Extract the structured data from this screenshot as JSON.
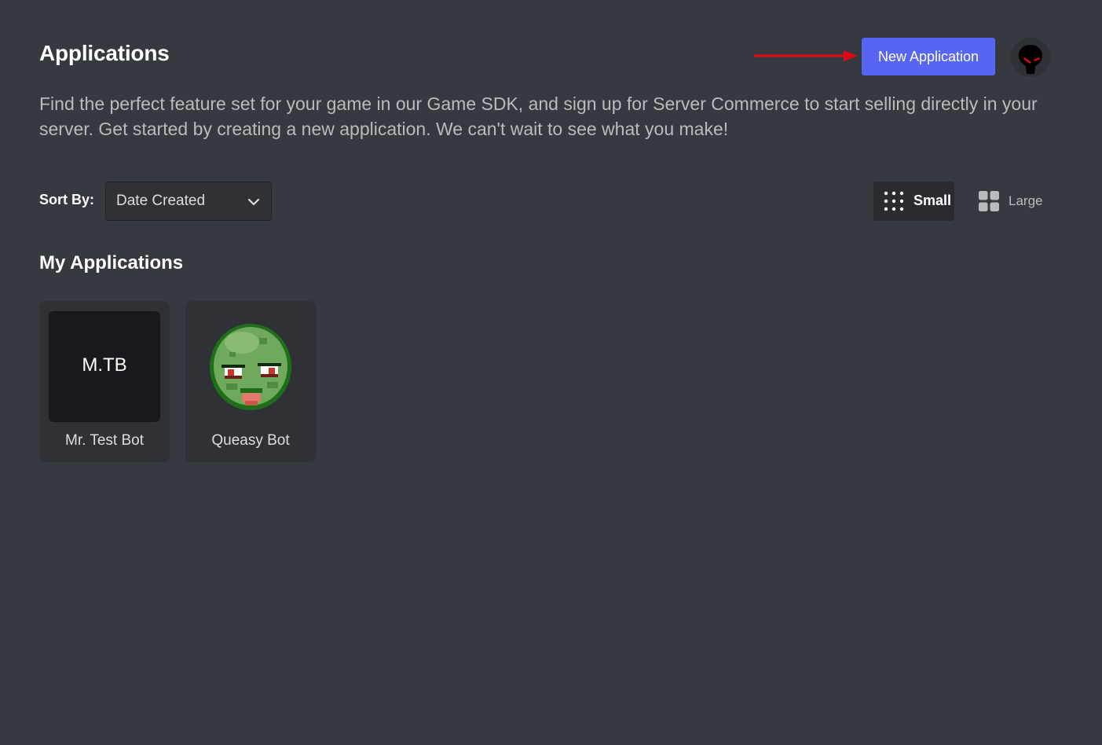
{
  "header": {
    "title": "Applications",
    "new_app_label": "New Application"
  },
  "description": "Find the perfect feature set for your game in our Game SDK, and sign up for Server Commerce to start selling directly in your server. Get started by creating a new application. We can't wait to see what you make!",
  "sort": {
    "label": "Sort By:",
    "selected": "Date Created"
  },
  "view_toggle": {
    "small_label": "Small",
    "large_label": "Large",
    "active": "Small"
  },
  "section_title": "My Applications",
  "applications": [
    {
      "name": "Mr. Test Bot",
      "initials": "M.TB",
      "icon": "initials"
    },
    {
      "name": "Queasy Bot",
      "initials": "",
      "icon": "green-zombie-face-icon"
    }
  ],
  "colors": {
    "background": "#36393f",
    "card": "#2f3136",
    "brand": "#5865f2",
    "annotation_arrow": "#e30613"
  }
}
